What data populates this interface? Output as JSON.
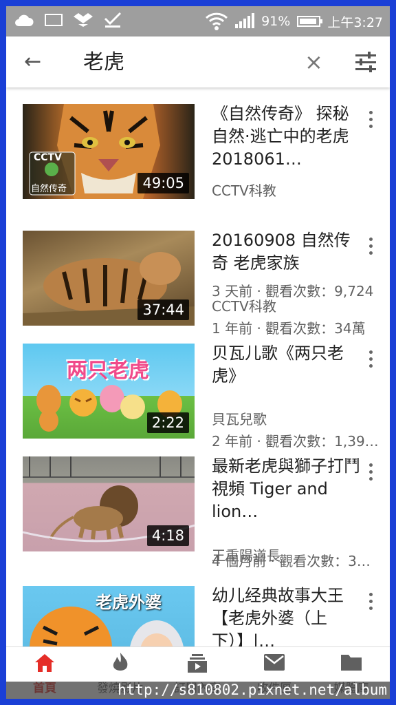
{
  "status_bar": {
    "battery": "91%",
    "time": "上午3:27"
  },
  "search": {
    "query": "老虎"
  },
  "videos": [
    {
      "title": "《自然传奇》 探秘自然·逃亡中的老虎 2018061…",
      "channel": "CCTV科教",
      "meta": "3 天前 · 觀看次數：9,724",
      "duration": "49:05",
      "thumb_label": "自然传奇"
    },
    {
      "title": "20160908 自然传奇  老虎家族",
      "channel": "CCTV科教",
      "meta": "1 年前 · 觀看次數：34萬",
      "duration": "37:44"
    },
    {
      "title": "贝瓦儿歌《两只老虎》",
      "channel": "貝瓦兒歌",
      "meta": "2 年前 · 觀看次數：1,39…",
      "duration": "2:22",
      "thumb_label": "两只老虎"
    },
    {
      "title": "最新老虎與獅子打鬥視頻 Tiger and lion…",
      "channel": "王重陽道長",
      "meta": "4 個月前 · 觀看次數：3…",
      "duration": "4:18"
    },
    {
      "title": "幼儿经典故事大王【老虎外婆（上下）】|…",
      "channel": "",
      "meta": "",
      "duration": "",
      "thumb_label": "老虎外婆"
    }
  ],
  "nav": {
    "tabs": [
      "首頁",
      "發燒影片",
      "訂閱內容",
      "收件匣",
      "媒體庫"
    ]
  },
  "watermark": "http://s810802.pixnet.net/album",
  "colors": {
    "accent": "#e52d27",
    "frame": "#1a3fd6",
    "status": "#9e9e9e"
  }
}
